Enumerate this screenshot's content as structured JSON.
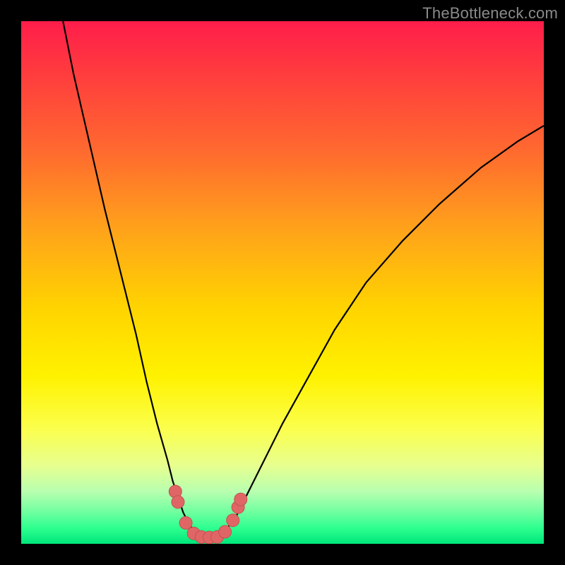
{
  "watermark": "TheBottleneck.com",
  "colors": {
    "frame": "#000000",
    "marker": "#e06666",
    "line": "#000000",
    "gradient_top": "#ff1d4b",
    "gradient_bottom": "#00e57a"
  },
  "chart_data": {
    "type": "line",
    "title": "",
    "xlabel": "",
    "ylabel": "",
    "xlim": [
      0,
      100
    ],
    "ylim": [
      0,
      100
    ],
    "series": [
      {
        "name": "left-branch",
        "x": [
          8,
          10,
          13,
          16,
          19,
          22,
          24,
          26,
          28,
          29,
          30,
          31,
          32,
          33,
          34
        ],
        "y": [
          100,
          90,
          77,
          64,
          52,
          40,
          31,
          23,
          16,
          12,
          9,
          6,
          4,
          2.5,
          1.5
        ]
      },
      {
        "name": "right-branch",
        "x": [
          38,
          39,
          41,
          43,
          46,
          50,
          55,
          60,
          66,
          73,
          80,
          88,
          95,
          100
        ],
        "y": [
          1.5,
          2.5,
          5,
          9,
          15,
          23,
          32,
          41,
          50,
          58,
          65,
          72,
          77,
          80
        ]
      },
      {
        "name": "valley-floor",
        "x": [
          34,
          35,
          36,
          37,
          38
        ],
        "y": [
          1.5,
          1,
          1,
          1,
          1.5
        ]
      }
    ],
    "markers": {
      "name": "highlighted-points",
      "points": [
        {
          "x": 29.5,
          "y": 10
        },
        {
          "x": 30,
          "y": 8
        },
        {
          "x": 31.5,
          "y": 4
        },
        {
          "x": 33,
          "y": 2
        },
        {
          "x": 34.5,
          "y": 1.3
        },
        {
          "x": 36,
          "y": 1.2
        },
        {
          "x": 37.5,
          "y": 1.3
        },
        {
          "x": 39,
          "y": 2.3
        },
        {
          "x": 40.5,
          "y": 4.5
        },
        {
          "x": 41.5,
          "y": 7
        },
        {
          "x": 42,
          "y": 8.5
        }
      ]
    }
  }
}
